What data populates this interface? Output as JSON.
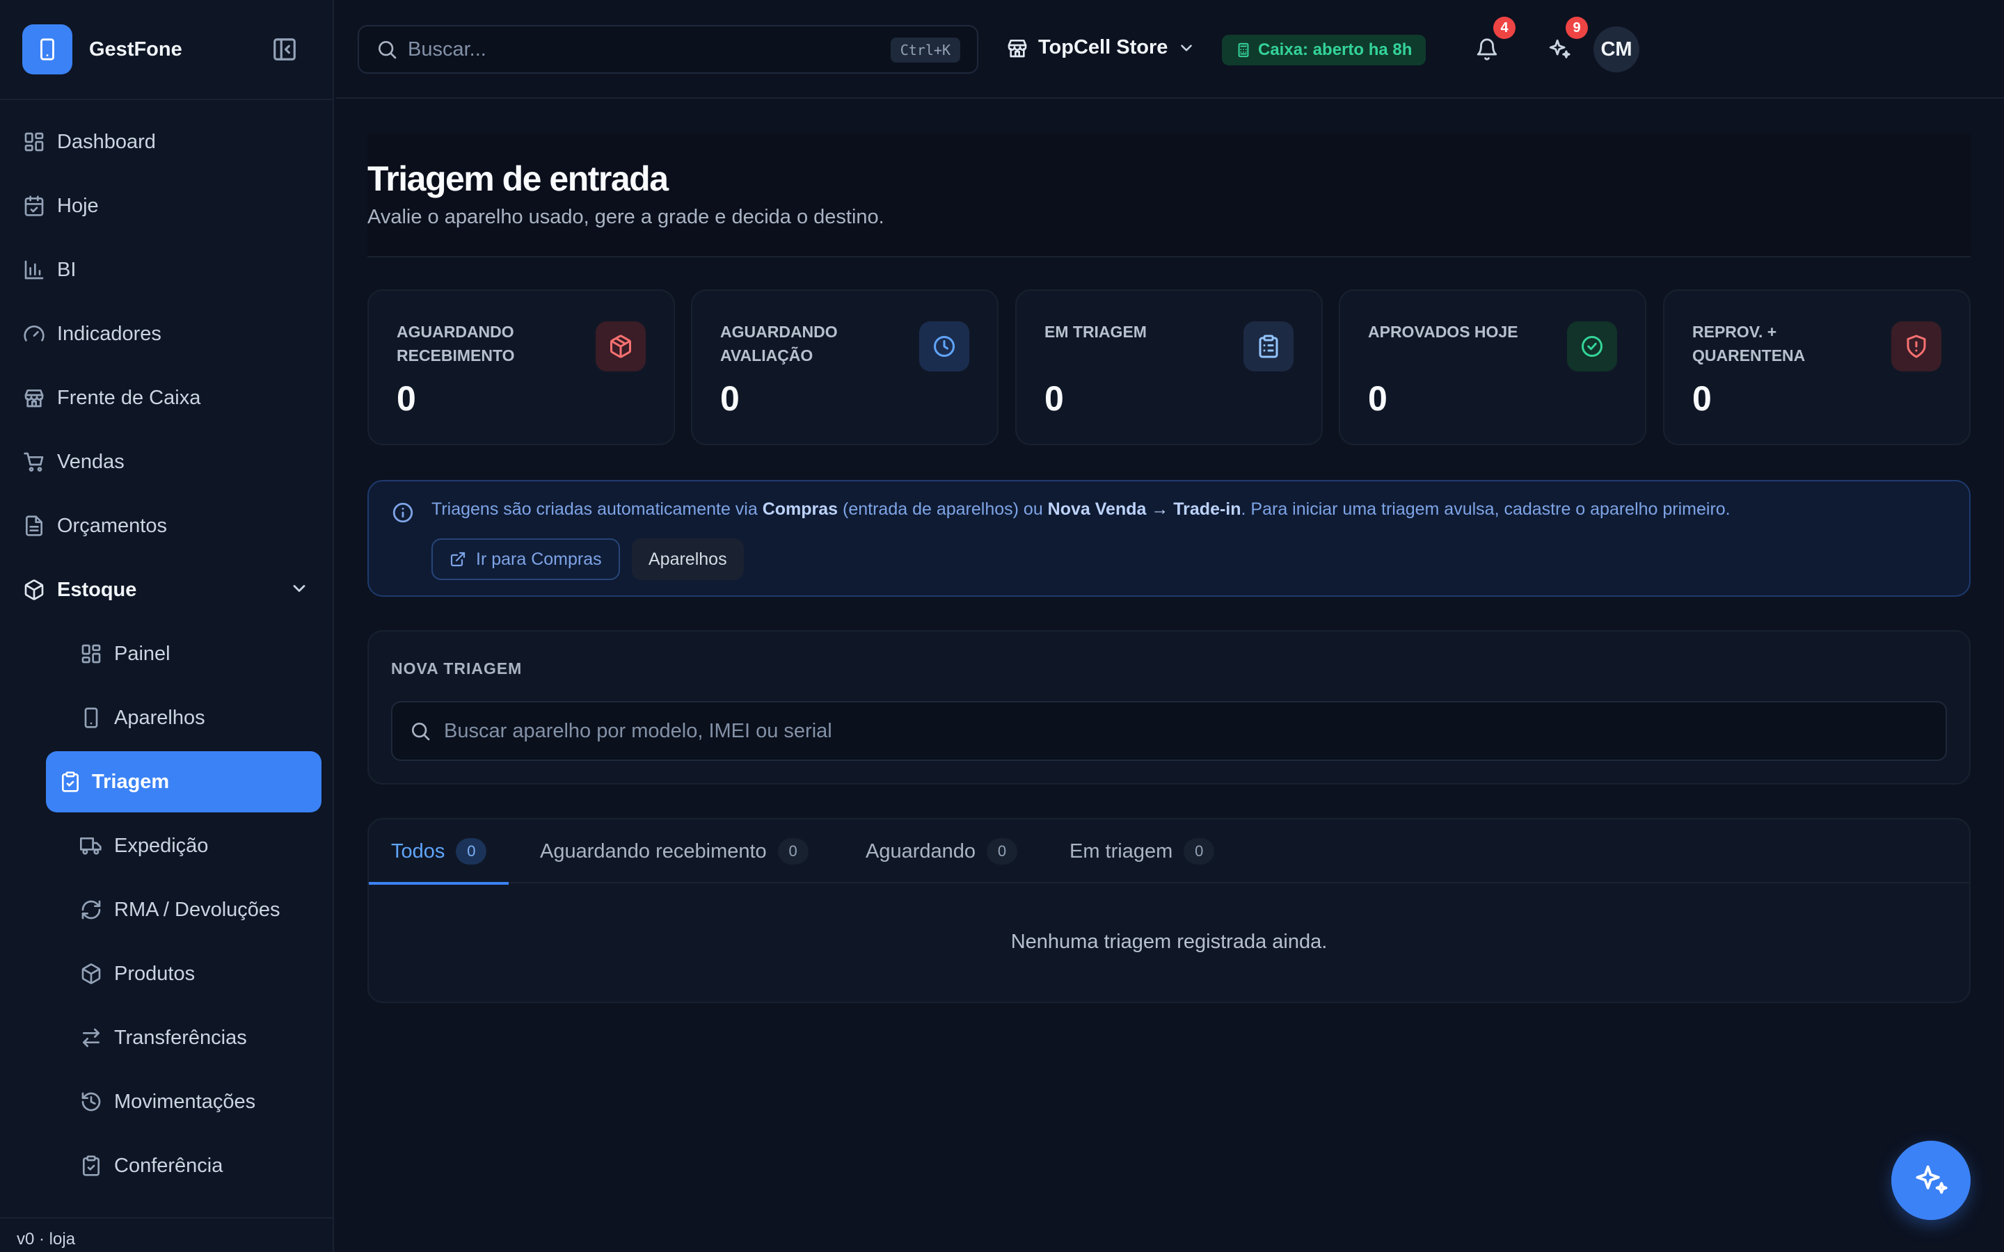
{
  "app": {
    "name": "GestFone"
  },
  "sidebar": {
    "items": [
      {
        "label": "Dashboard",
        "icon": "dashboard-icon"
      },
      {
        "label": "Hoje",
        "icon": "calendar-icon"
      },
      {
        "label": "BI",
        "icon": "bar-chart-icon"
      },
      {
        "label": "Indicadores",
        "icon": "gauge-icon"
      },
      {
        "label": "Frente de Caixa",
        "icon": "store-icon"
      },
      {
        "label": "Vendas",
        "icon": "cart-icon"
      },
      {
        "label": "Orçamentos",
        "icon": "document-icon"
      }
    ],
    "group": {
      "label": "Estoque",
      "icon": "box-icon",
      "expanded": true
    },
    "subitems": [
      {
        "label": "Painel",
        "icon": "dashboard-icon"
      },
      {
        "label": "Aparelhos",
        "icon": "smartphone-icon"
      },
      {
        "label": "Triagem",
        "icon": "clipboard-check-icon",
        "active": true
      },
      {
        "label": "Expedição",
        "icon": "truck-icon"
      },
      {
        "label": "RMA / Devoluções",
        "icon": "refresh-icon"
      },
      {
        "label": "Produtos",
        "icon": "box-icon"
      },
      {
        "label": "Transferências",
        "icon": "swap-icon"
      },
      {
        "label": "Movimentações",
        "icon": "history-icon"
      },
      {
        "label": "Conferência",
        "icon": "clipboard-icon"
      }
    ],
    "version": "v0 · loja"
  },
  "topbar": {
    "search_placeholder": "Buscar...",
    "search_shortcut": "Ctrl+K",
    "store_name": "TopCell Store",
    "caixa_status": "Caixa: aberto ha 8h",
    "notifications_count": "4",
    "ai_count": "9",
    "avatar_initials": "CM"
  },
  "page": {
    "title": "Triagem de entrada",
    "subtitle": "Avalie o aparelho usado, gere a grade e decida o destino."
  },
  "stats": [
    {
      "label": "AGUARDANDO RECEBIMENTO",
      "value": "0",
      "icon": "package-icon",
      "color": "#f87171"
    },
    {
      "label": "AGUARDANDO AVALIAÇÃO",
      "value": "0",
      "icon": "clock-icon",
      "color": "#60a5fa"
    },
    {
      "label": "EM TRIAGEM",
      "value": "0",
      "icon": "clipboard-list-icon",
      "color": "#93c5fd"
    },
    {
      "label": "APROVADOS HOJE",
      "value": "0",
      "icon": "check-circle-icon",
      "color": "#34d399"
    },
    {
      "label": "REPROV. + QUARENTENA",
      "value": "0",
      "icon": "shield-alert-icon",
      "color": "#f87171"
    }
  ],
  "info": {
    "text_1": "Triagens são criadas automaticamente via ",
    "link_1": "Compras",
    "text_2": " (entrada de aparelhos) ou ",
    "link_2": "Nova Venda → Trade-in",
    "text_3": ". Para iniciar uma triagem avulsa, cadastre o aparelho primeiro.",
    "button_primary": "Ir para Compras",
    "button_secondary": "Aparelhos"
  },
  "new_triagem": {
    "label": "NOVA TRIAGEM",
    "search_placeholder": "Buscar aparelho por modelo, IMEI ou serial"
  },
  "tabs": [
    {
      "label": "Todos",
      "count": "0",
      "active": true
    },
    {
      "label": "Aguardando recebimento",
      "count": "0"
    },
    {
      "label": "Aguardando",
      "count": "0"
    },
    {
      "label": "Em triagem",
      "count": "0"
    }
  ],
  "empty_state": "Nenhuma triagem registrada ainda.",
  "colors": {
    "accent": "#3b82f6",
    "background": "#0c1220",
    "success": "#34d399",
    "danger": "#ef4444"
  }
}
